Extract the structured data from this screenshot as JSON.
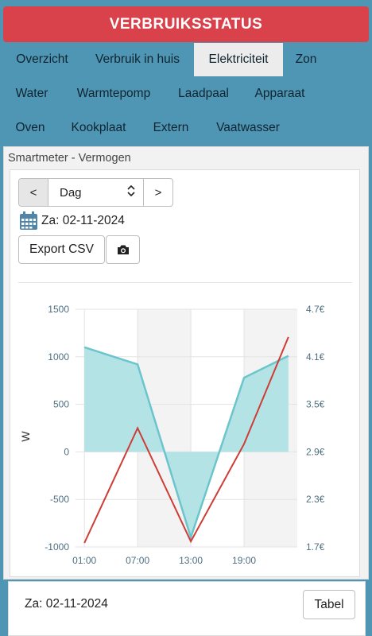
{
  "header": {
    "title": "VERBRUIKSSTATUS"
  },
  "tabs": [
    {
      "label": "Overzicht"
    },
    {
      "label": "Verbruik in huis"
    },
    {
      "label": "Elektriciteit",
      "active": true
    },
    {
      "label": "Zon"
    },
    {
      "label": "Water"
    },
    {
      "label": "Warmtepomp"
    },
    {
      "label": "Laadpaal"
    },
    {
      "label": "Apparaat"
    },
    {
      "label": "Oven"
    },
    {
      "label": "Kookplaat"
    },
    {
      "label": "Extern"
    },
    {
      "label": "Vaatwasser"
    }
  ],
  "panel": {
    "title": "Smartmeter - Vermogen",
    "nav": {
      "prev": "<",
      "period": "Dag",
      "next": ">"
    },
    "date": "Za: 02-11-2024",
    "export_label": "Export CSV",
    "camera_icon": "camera-icon",
    "calendar_icon": "calendar-icon"
  },
  "chart_data": {
    "type": "area",
    "ylabel": "W",
    "x_ticks": [
      "01:00",
      "07:00",
      "13:00",
      "19:00"
    ],
    "y_left_ticks": [
      "1500",
      "1000",
      "500",
      "0",
      "-500",
      "-1000"
    ],
    "y_right_ticks": [
      "4.7€",
      "4.1€",
      "3.5€",
      "2.9€",
      "2.3€",
      "1.7€"
    ],
    "ylim": [
      -1000,
      1500
    ],
    "y2lim": [
      1.7,
      4.7
    ],
    "grid": true,
    "series": [
      {
        "kind": "area",
        "color": "#6cc5cc",
        "fill": "#b3e3e5",
        "x": [
          1,
          7,
          13,
          19,
          24
        ],
        "values": [
          1100,
          920,
          -900,
          780,
          1010
        ]
      },
      {
        "kind": "line",
        "axis": "right",
        "color": "#cf3c36",
        "x": [
          1,
          7,
          13,
          19,
          24
        ],
        "values": [
          1.75,
          3.2,
          1.77,
          3.0,
          4.35
        ]
      }
    ]
  },
  "bottom": {
    "date": "Za: 02-11-2024",
    "table_label": "Tabel"
  }
}
